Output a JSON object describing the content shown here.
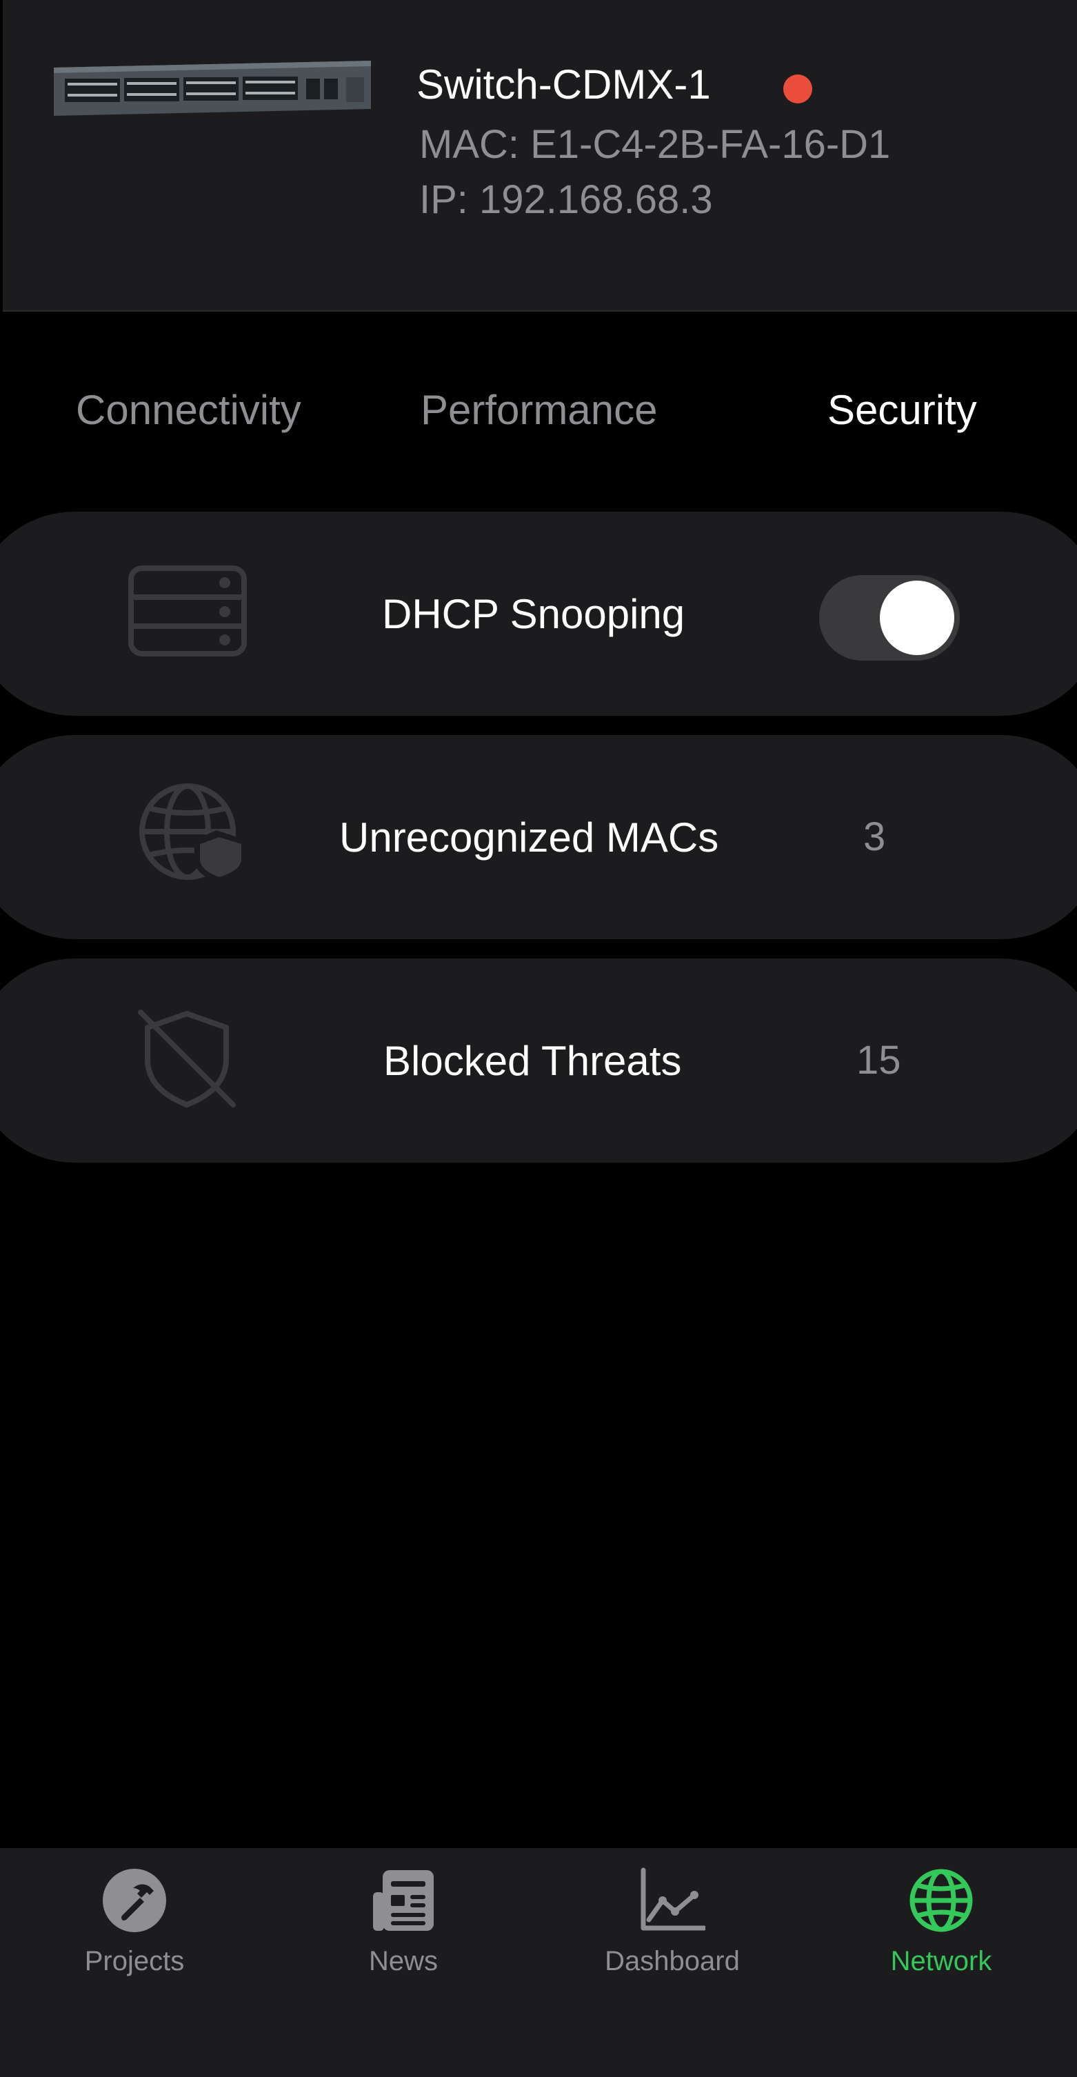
{
  "device": {
    "name": "Switch-CDMX-1",
    "mac": "MAC: E1-C4-2B-FA-16-D1",
    "ip": "IP: 192.168.68.3",
    "status_color": "#eb4d3d"
  },
  "tabs": [
    {
      "label": "Connectivity",
      "active": false
    },
    {
      "label": "Performance",
      "active": false
    },
    {
      "label": "Security",
      "active": true
    }
  ],
  "security": {
    "dhcp": {
      "label": "DHCP Snooping",
      "enabled": true,
      "icon": "server-rack-icon"
    },
    "unrecognized": {
      "label": "Unrecognized MACs",
      "value": "3",
      "icon": "globe-shield-icon"
    },
    "threats": {
      "label": "Blocked Threats",
      "value": "15",
      "icon": "shield-slash-icon"
    }
  },
  "tabbar": {
    "items": [
      {
        "label": "Projects",
        "icon": "hammer-icon"
      },
      {
        "label": "News",
        "icon": "newspaper-icon"
      },
      {
        "label": "Dashboard",
        "icon": "chart-line-icon"
      },
      {
        "label": "Network",
        "icon": "globe-icon",
        "active": true
      }
    ],
    "active_color": "#34c759",
    "inactive_color": "#8e8e93"
  }
}
